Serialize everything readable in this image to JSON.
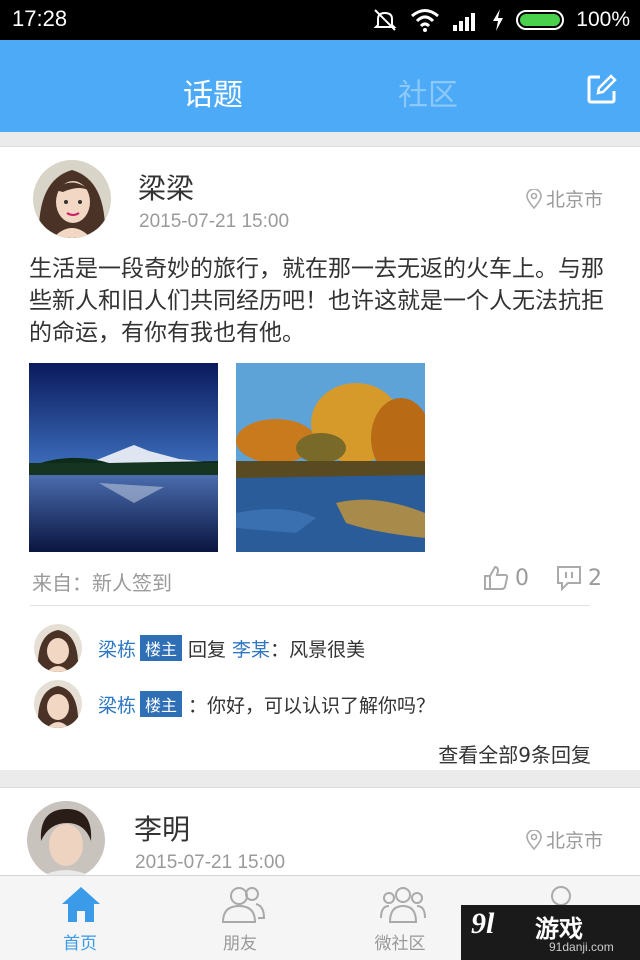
{
  "status_bar": {
    "time": "17:28",
    "battery_percent": "100%"
  },
  "header": {
    "tabs": [
      {
        "label": "话题",
        "active": true
      },
      {
        "label": "社区",
        "active": false
      }
    ]
  },
  "posts": [
    {
      "author": "梁梁",
      "time": "2015-07-21 15:00",
      "location": "北京市",
      "text": "生活是一段奇妙的旅行，就在那一去无返的火车上。与那些新人和旧人们共同经历吧！也许这就是一个人无法抗拒的命运，有你有我也有他。",
      "source": "来自：新人签到",
      "likes": "0",
      "comments": "2",
      "replies": [
        {
          "user": "梁栋",
          "badge": "楼主",
          "action": "回复",
          "target": "李某",
          "text": "：风景很美"
        },
        {
          "user": "梁栋",
          "badge": "楼主",
          "text": "：你好，可以认识了解你吗？"
        }
      ],
      "view_all": "查看全部9条回复"
    },
    {
      "author": "李明",
      "time": "2015-07-21 15:00",
      "location": "北京市"
    }
  ],
  "tabbar": [
    {
      "label": "首页",
      "icon": "home-icon",
      "active": true
    },
    {
      "label": "朋友",
      "icon": "friends-icon",
      "active": false
    },
    {
      "label": "微社区",
      "icon": "community-icon",
      "active": false
    }
  ],
  "watermark": {
    "logo": "9l",
    "title": "游戏",
    "site": "91danji.com"
  },
  "colors": {
    "header": "#4daaf7",
    "accent": "#3b9be8",
    "badge": "#2f6fb5",
    "link": "#2f78c2"
  }
}
